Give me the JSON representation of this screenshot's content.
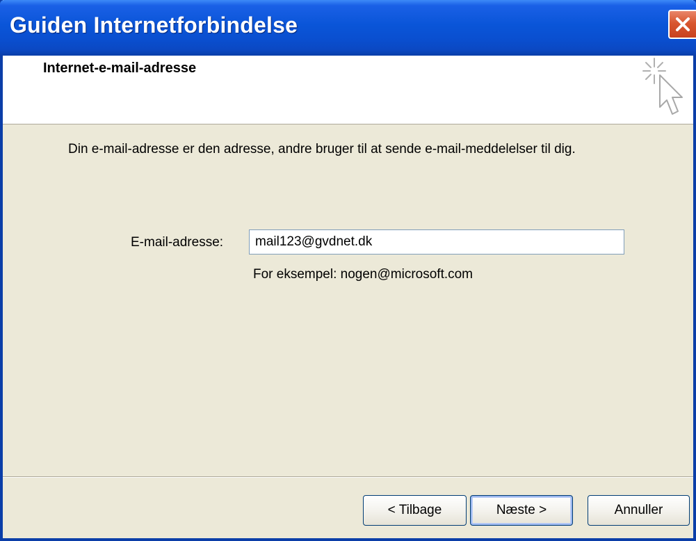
{
  "window": {
    "title": "Guiden Internetforbindelse",
    "close_icon": "close-icon"
  },
  "header": {
    "title": "Internet-e-mail-adresse",
    "icon": "wizard-cursor-icon"
  },
  "content": {
    "description": "Din e-mail-adresse er den adresse, andre bruger til at sende e-mail-meddelelser til dig.",
    "email_label": "E-mail-adresse:",
    "email_value": "mail123@gvdnet.dk",
    "example": "For eksempel: nogen@microsoft.com"
  },
  "buttons": {
    "back": "< Tilbage",
    "next": "Næste >",
    "cancel": "Annuller"
  },
  "colors": {
    "titlebar": "#0a55d8",
    "close": "#d8562f",
    "dialog_bg": "#ece9d8"
  }
}
